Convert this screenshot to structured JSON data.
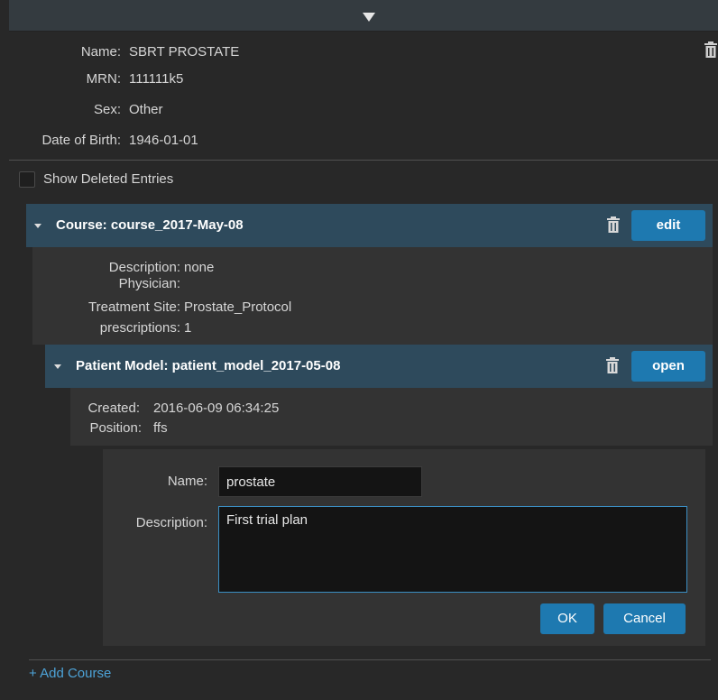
{
  "patient": {
    "fields": [
      {
        "label": "Name:",
        "value": "SBRT PROSTATE"
      },
      {
        "label": "MRN:",
        "value": "111111k5"
      },
      {
        "label": "Sex:",
        "value": "Other"
      },
      {
        "label": "Date of Birth:",
        "value": "1946-01-01"
      }
    ]
  },
  "show_deleted": {
    "label": "Show Deleted Entries",
    "checked": false
  },
  "course": {
    "title": "Course: course_2017-May-08",
    "edit_label": "edit",
    "fields": [
      {
        "label": "Description:",
        "value": "none"
      },
      {
        "label": "Physician:",
        "value": ""
      },
      {
        "label": "Treatment Site:",
        "value": "Prostate_Protocol"
      },
      {
        "label": "prescriptions:",
        "value": "1"
      }
    ]
  },
  "patient_model": {
    "title": "Patient Model: patient_model_2017-05-08",
    "open_label": "open",
    "fields": [
      {
        "label": "Created:",
        "value": "2016-06-09 06:34:25"
      },
      {
        "label": "Position:",
        "value": "ffs"
      }
    ]
  },
  "plan_form": {
    "name_label": "Name:",
    "name_value": "prostate",
    "description_label": "Description:",
    "description_value": "First trial plan",
    "ok_label": "OK",
    "cancel_label": "Cancel"
  },
  "add_course_label": "+ Add Course",
  "colors": {
    "background": "#282828",
    "header_bar": "#2e4a5c",
    "button": "#1e79b0",
    "link": "#4da3d8",
    "input_focus_border": "#3b8fc4"
  }
}
